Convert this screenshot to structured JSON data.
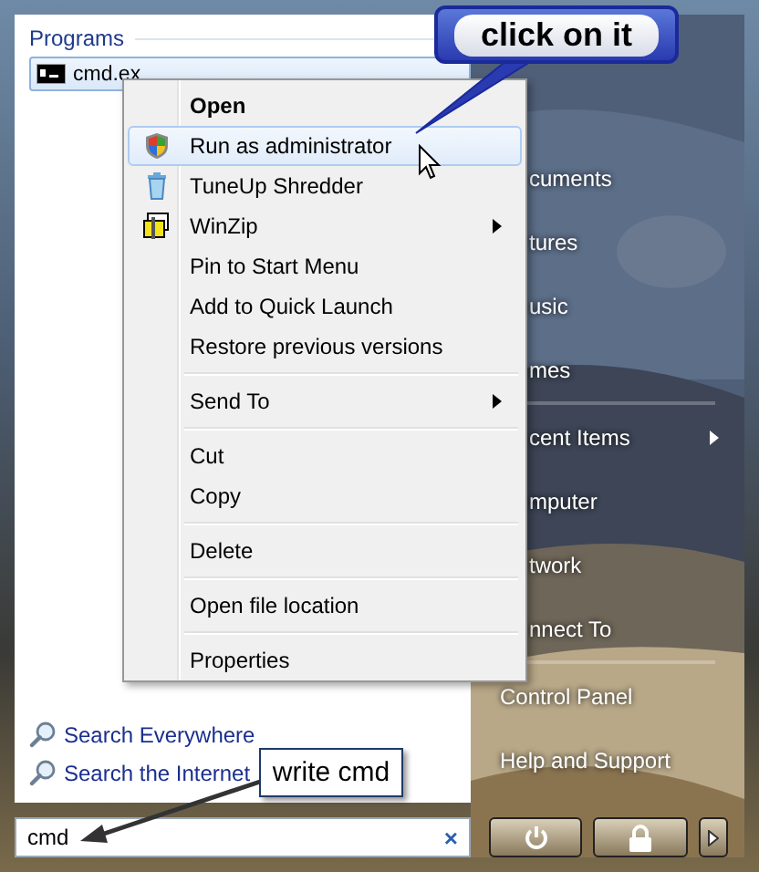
{
  "programs": {
    "heading": "Programs",
    "items": [
      {
        "label": "cmd.ex",
        "selected": true
      }
    ]
  },
  "context_menu": {
    "groups": [
      [
        {
          "label": "Open",
          "bold": true,
          "kind": "plain",
          "submenu": false,
          "selected": false
        },
        {
          "label": "Run as administrator",
          "bold": false,
          "kind": "shield",
          "submenu": false,
          "selected": true
        },
        {
          "label": "TuneUp Shredder",
          "bold": false,
          "kind": "trash",
          "submenu": false,
          "selected": false
        },
        {
          "label": "WinZip",
          "bold": false,
          "kind": "zip",
          "submenu": true,
          "selected": false
        },
        {
          "label": "Pin to Start Menu",
          "bold": false,
          "kind": "plain",
          "submenu": false,
          "selected": false
        },
        {
          "label": "Add to Quick Launch",
          "bold": false,
          "kind": "plain",
          "submenu": false,
          "selected": false
        },
        {
          "label": "Restore previous versions",
          "bold": false,
          "kind": "plain",
          "submenu": false,
          "selected": false
        }
      ],
      [
        {
          "label": "Send To",
          "bold": false,
          "kind": "plain",
          "submenu": true,
          "selected": false
        }
      ],
      [
        {
          "label": "Cut",
          "bold": false,
          "kind": "plain",
          "submenu": false,
          "selected": false
        },
        {
          "label": "Copy",
          "bold": false,
          "kind": "plain",
          "submenu": false,
          "selected": false
        }
      ],
      [
        {
          "label": "Delete",
          "bold": false,
          "kind": "plain",
          "submenu": false,
          "selected": false
        }
      ],
      [
        {
          "label": "Open file location",
          "bold": false,
          "kind": "plain",
          "submenu": false,
          "selected": false
        }
      ],
      [
        {
          "label": "Properties",
          "bold": false,
          "kind": "plain",
          "submenu": false,
          "selected": false
        }
      ]
    ]
  },
  "search_links": [
    "Search Everywhere",
    "Search the Internet"
  ],
  "search": {
    "value": "cmd",
    "clear": "×"
  },
  "right_groups": [
    [
      {
        "label": "cuments",
        "covered": true,
        "submenu": false
      },
      {
        "label": "tures",
        "covered": true,
        "submenu": false
      },
      {
        "label": "usic",
        "covered": true,
        "submenu": false
      },
      {
        "label": "mes",
        "covered": true,
        "submenu": false
      }
    ],
    [
      {
        "label": "cent Items",
        "covered": true,
        "submenu": true
      },
      {
        "label": "mputer",
        "covered": true,
        "submenu": false
      },
      {
        "label": "twork",
        "covered": true,
        "submenu": false
      },
      {
        "label": "nnect To",
        "covered": true,
        "submenu": false
      }
    ],
    [
      {
        "label": "Control Panel",
        "covered": false,
        "submenu": false
      },
      {
        "label": "Help and Support",
        "covered": false,
        "submenu": false
      }
    ]
  ],
  "callouts": [
    {
      "kind": "bubble",
      "text": "click on it"
    },
    {
      "kind": "box",
      "text": "write cmd"
    }
  ]
}
